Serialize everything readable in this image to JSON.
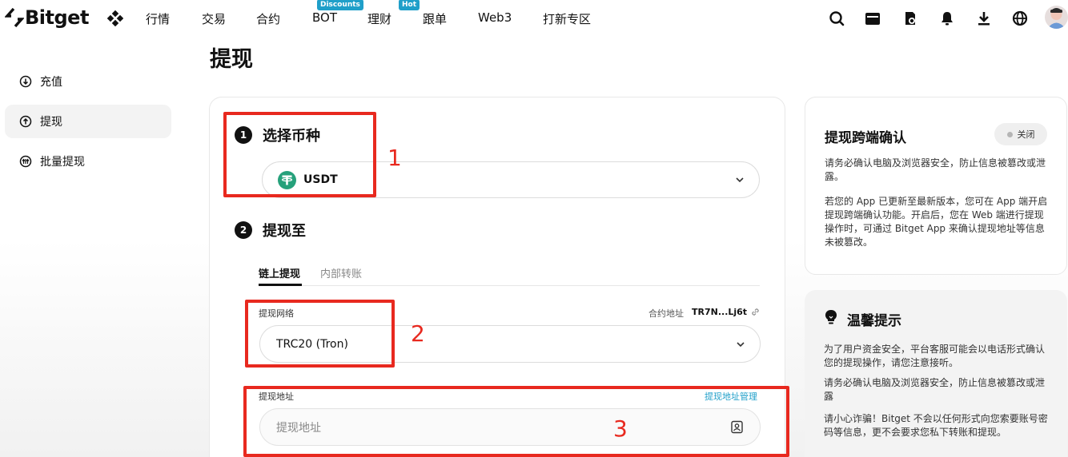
{
  "nav": {
    "logo_text": "Bitget",
    "items": [
      {
        "label": "行情"
      },
      {
        "label": "交易"
      },
      {
        "label": "合约"
      },
      {
        "label": "BOT",
        "badge": "Discounts"
      },
      {
        "label": "理财",
        "badge": "Hot"
      },
      {
        "label": "跟单"
      },
      {
        "label": "Web3"
      },
      {
        "label": "打新专区"
      }
    ],
    "icons": [
      "search-icon",
      "wallet-icon",
      "orders-icon",
      "bell-icon",
      "download-icon",
      "globe-icon"
    ],
    "badge_color": "#1f9fc9"
  },
  "page_title": "提现",
  "sidebar": {
    "items": [
      {
        "label": "充值",
        "icon": "deposit-icon"
      },
      {
        "label": "提现",
        "icon": "withdraw-icon",
        "active": true
      },
      {
        "label": "批量提现",
        "icon": "batch-withdraw-icon"
      }
    ]
  },
  "form": {
    "step1": {
      "num": "1",
      "title": "选择币种"
    },
    "coin": {
      "value": "USDT",
      "icon": "tether-icon",
      "icon_color": "#26a17b"
    },
    "step2": {
      "num": "2",
      "title": "提现至"
    },
    "tabs": [
      {
        "label": "链上提现",
        "active": true
      },
      {
        "label": "内部转账",
        "active": false
      }
    ],
    "network": {
      "label": "提现网络",
      "contract_label": "合约地址",
      "contract_value": "TR7N...Lj6t",
      "value": "TRC20 (Tron)"
    },
    "address": {
      "label": "提现地址",
      "manage_link": "提现地址管理",
      "placeholder": "提现地址"
    }
  },
  "cross_confirm": {
    "title": "提现跨端确认",
    "toggle_label": "关闭",
    "p1": "请务必确认电脑及浏览器安全，防止信息被篡改或泄露。",
    "p2": "若您的 App 已更新至最新版本，您可在 App 端开启提现跨端确认功能。开启后，您在 Web 端进行提现操作时，可通过 Bitget App 来确认提现地址等信息未被篡改。"
  },
  "tips": {
    "title": "温馨提示",
    "p1": "为了用户资金安全，平台客服可能会以电话形式确认您的提现操作，请您注意接听。",
    "p2": "请务必确认电脑及浏览器安全，防止信息被篡改或泄露",
    "p3": "请小心诈骗！Bitget 不会以任何形式向您索要账号密码等信息，更不会要求您私下转账和提现。"
  },
  "annotations": [
    {
      "label": "1"
    },
    {
      "label": "2"
    },
    {
      "label": "3"
    }
  ],
  "annotation_color": "#e8291f"
}
